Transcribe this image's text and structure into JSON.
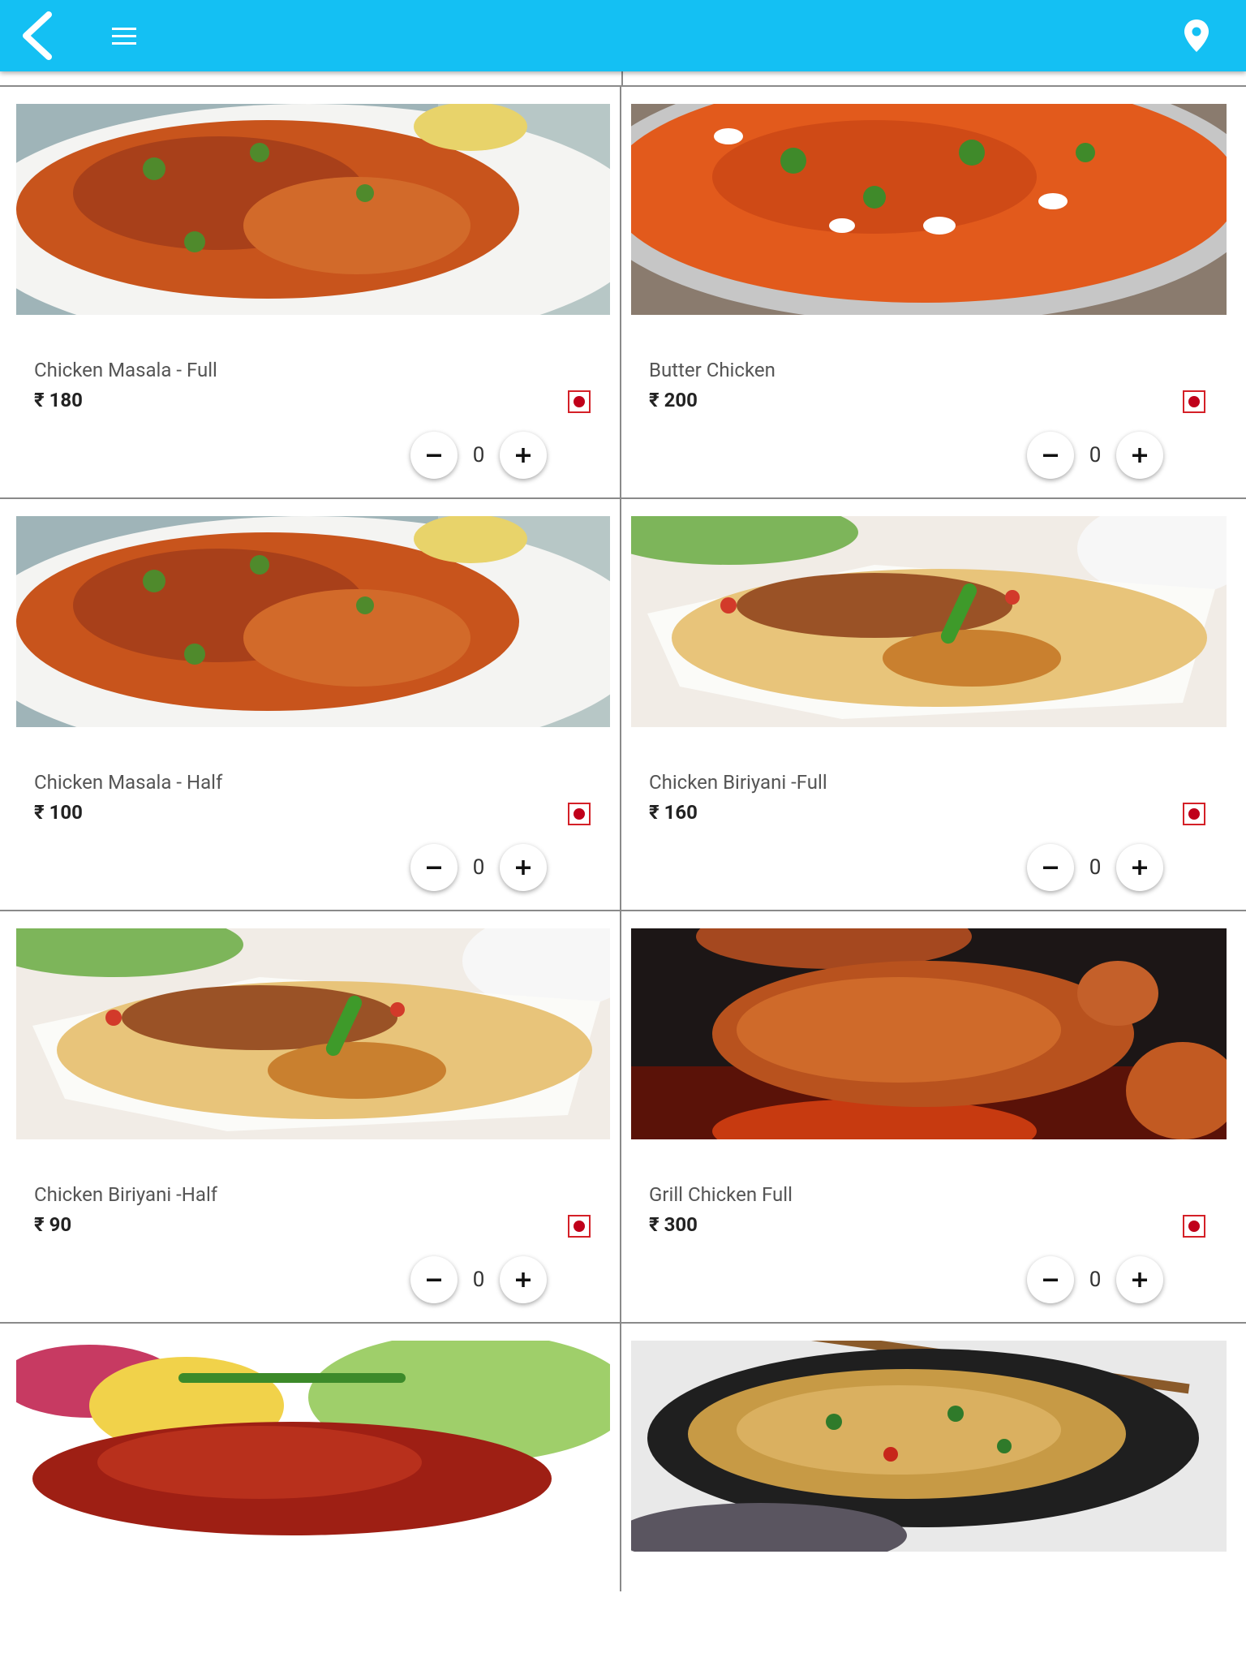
{
  "app_bar": {
    "color": "#14c0f3",
    "icons": [
      "back-arrow-icon",
      "hamburger-menu-icon",
      "location-pin-icon"
    ]
  },
  "currency_symbol": "₹",
  "items": [
    {
      "name": "Chicken Masala - Full",
      "price": "₹ 180",
      "qty": "0",
      "image": "chicken-masala",
      "type": "non-veg"
    },
    {
      "name": "Butter Chicken",
      "price": "₹ 200",
      "qty": "0",
      "image": "butter-chicken",
      "type": "non-veg"
    },
    {
      "name": "Chicken Masala - Half",
      "price": "₹ 100",
      "qty": "0",
      "image": "chicken-masala",
      "type": "non-veg"
    },
    {
      "name": "Chicken Biriyani -Full",
      "price": "₹ 160",
      "qty": "0",
      "image": "chicken-biriyani",
      "type": "non-veg"
    },
    {
      "name": "Chicken Biriyani -Half",
      "price": "₹ 90",
      "qty": "0",
      "image": "chicken-biriyani",
      "type": "non-veg"
    },
    {
      "name": "Grill Chicken Full",
      "price": "₹ 300",
      "qty": "0",
      "image": "grill-chicken",
      "type": "non-veg"
    },
    {
      "image": "chicken-65"
    },
    {
      "image": "noodles"
    }
  ],
  "colors": {
    "nonveg_marker": "#c0001a",
    "divider": "#8a8a8a"
  }
}
